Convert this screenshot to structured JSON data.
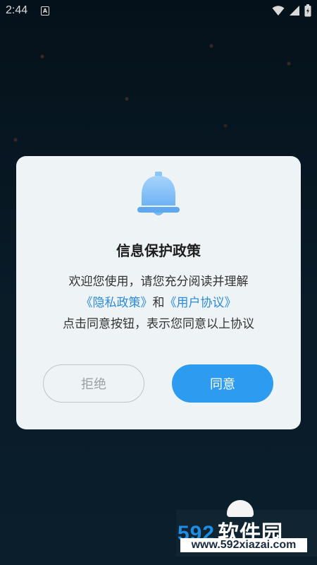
{
  "status_bar": {
    "time": "2:44",
    "notification_icon": "a-icon",
    "icons": [
      "wifi-icon",
      "signal-icon",
      "battery-icon"
    ]
  },
  "dialog": {
    "title": "信息保护政策",
    "body_line1": "欢迎您使用，请您充分阅读并理解",
    "privacy_link": "《隐私政策》",
    "and_text": "和",
    "agreement_link": "《用户协议》",
    "body_line3": "点击同意按钮，表示您同意以上协议",
    "reject_label": "拒绝",
    "agree_label": "同意",
    "icon": "bell-icon"
  },
  "watermark": {
    "number": "592",
    "brand": "软件园",
    "url": "www.592xiazai.com"
  },
  "colors": {
    "accent": "#2c9bf0",
    "link": "#2c8ad8",
    "background": "#0b1d2a",
    "dialog_bg": "#eef3f6"
  }
}
